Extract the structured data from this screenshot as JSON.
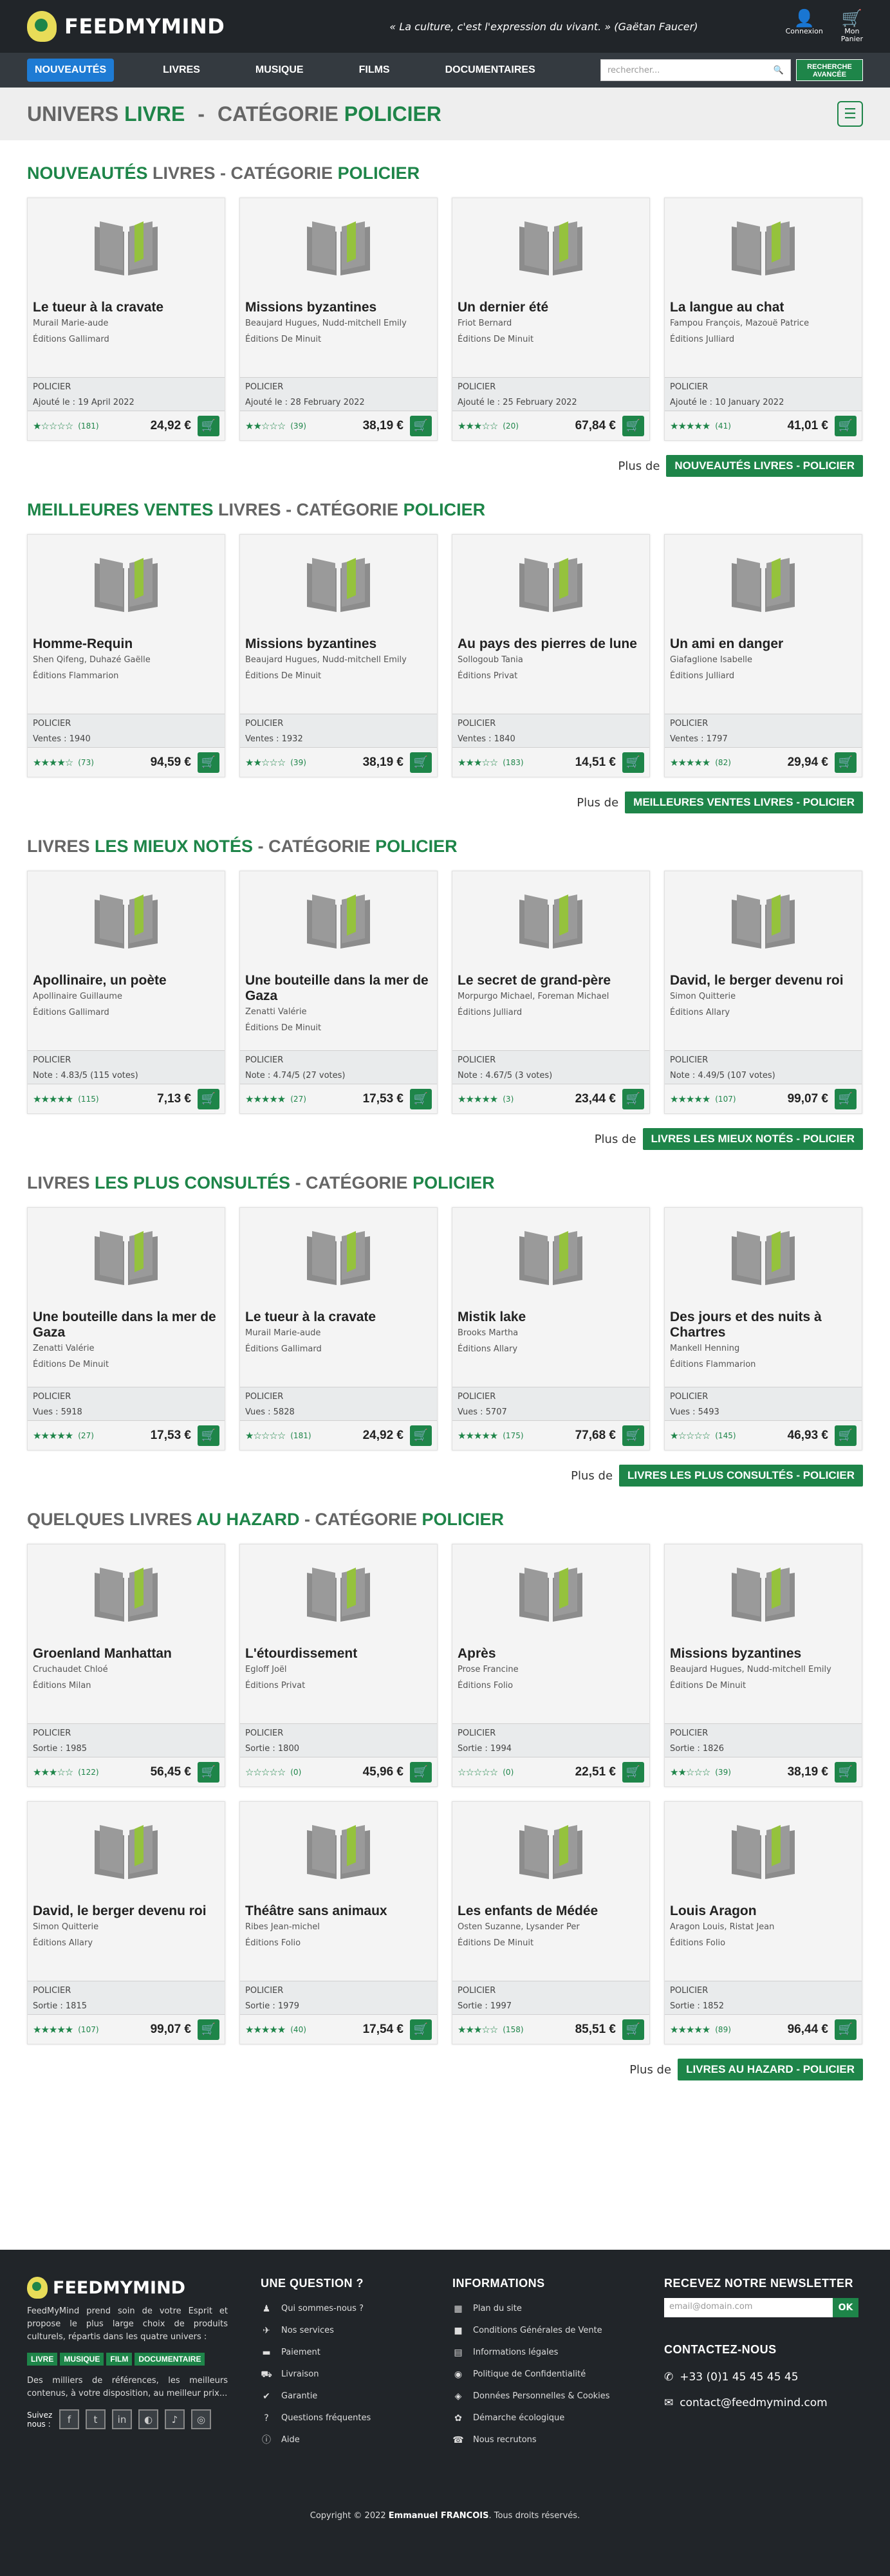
{
  "header": {
    "logo_text": "FEEDMYMIND",
    "quote": "« La culture, c'est l'expression du vivant. »",
    "quote_author": "(Gaëtan Faucer)",
    "login_label": "Connexion",
    "cart_label_1": "Mon",
    "cart_label_2": "Panier"
  },
  "nav": {
    "items": [
      "NOUVEAUTÉS",
      "LIVRES",
      "MUSIQUE",
      "FILMS",
      "DOCUMENTAIRES"
    ],
    "search_placeholder": "rechercher...",
    "adv_search_1": "RECHERCHE",
    "adv_search_2": "AVANCÉE"
  },
  "page": {
    "title_a": "UNIVERS ",
    "title_b": "LIVRE",
    "title_sep": "-",
    "title_c": "CATÉGORIE ",
    "title_d": "POLICIER"
  },
  "more_label": "Plus de",
  "sections": [
    {
      "title_parts": [
        [
          "NOUVEAUTÉS",
          true
        ],
        [
          " LIVRES - CATÉGORIE ",
          false
        ],
        [
          "POLICIER",
          true
        ]
      ],
      "more_button": "NOUVEAUTÉS LIVRES - POLICIER",
      "rows": [
        [
          {
            "title": "Le tueur à la cravate",
            "author": "Murail Marie-aude",
            "publisher": "Éditions Gallimard",
            "category": "POLICIER",
            "stat": "Ajouté le : 19 April 2022",
            "stars": "★☆☆☆☆",
            "count": "(181)",
            "price": "24,92 €"
          },
          {
            "title": "Missions byzantines",
            "author": "Beaujard Hugues, Nudd-mitchell Emily",
            "publisher": "Éditions De Minuit",
            "category": "POLICIER",
            "stat": "Ajouté le : 28 February 2022",
            "stars": "★★☆☆☆",
            "count": "(39)",
            "price": "38,19 €"
          },
          {
            "title": "Un dernier été",
            "author": "Friot Bernard",
            "publisher": "Éditions De Minuit",
            "category": "POLICIER",
            "stat": "Ajouté le : 25 February 2022",
            "stars": "★★★☆☆",
            "count": "(20)",
            "price": "67,84 €"
          },
          {
            "title": "La langue au chat",
            "author": "Fampou François, Mazouë Patrice",
            "publisher": "Éditions Julliard",
            "category": "POLICIER",
            "stat": "Ajouté le : 10 January 2022",
            "stars": "★★★★★",
            "count": "(41)",
            "price": "41,01 €"
          }
        ]
      ]
    },
    {
      "title_parts": [
        [
          "MEILLEURES VENTES",
          true
        ],
        [
          " LIVRES - CATÉGORIE ",
          false
        ],
        [
          "POLICIER",
          true
        ]
      ],
      "more_button": "MEILLEURES VENTES LIVRES - POLICIER",
      "rows": [
        [
          {
            "title": "Homme-Requin",
            "author": "Shen Qifeng, Duhazé Gaëlle",
            "publisher": "Éditions Flammarion",
            "category": "POLICIER",
            "stat": "Ventes : 1940",
            "stars": "★★★★☆",
            "count": "(73)",
            "price": "94,59 €"
          },
          {
            "title": "Missions byzantines",
            "author": "Beaujard Hugues, Nudd-mitchell Emily",
            "publisher": "Éditions De Minuit",
            "category": "POLICIER",
            "stat": "Ventes : 1932",
            "stars": "★★☆☆☆",
            "count": "(39)",
            "price": "38,19 €"
          },
          {
            "title": "Au pays des pierres de lune",
            "author": "Sollogoub Tania",
            "publisher": "Éditions Privat",
            "category": "POLICIER",
            "stat": "Ventes : 1840",
            "stars": "★★★☆☆",
            "count": "(183)",
            "price": "14,51 €"
          },
          {
            "title": "Un ami en danger",
            "author": "Giafaglione Isabelle",
            "publisher": "Éditions Julliard",
            "category": "POLICIER",
            "stat": "Ventes : 1797",
            "stars": "★★★★★",
            "count": "(82)",
            "price": "29,94 €"
          }
        ]
      ]
    },
    {
      "title_parts": [
        [
          "LIVRES ",
          false
        ],
        [
          "LES MIEUX NOTÉS",
          true
        ],
        [
          " - CATÉGORIE ",
          false
        ],
        [
          "POLICIER",
          true
        ]
      ],
      "more_button": "LIVRES LES MIEUX NOTÉS - POLICIER",
      "rows": [
        [
          {
            "title": "Apollinaire, un poète",
            "author": "Apollinaire Guillaume",
            "publisher": "Éditions Gallimard",
            "category": "POLICIER",
            "stat": "Note : 4.83/5 (115 votes)",
            "stars": "★★★★★",
            "count": "(115)",
            "price": "7,13 €"
          },
          {
            "title": "Une bouteille dans la mer de Gaza",
            "author": "Zenatti Valérie",
            "publisher": "Éditions De Minuit",
            "category": "POLICIER",
            "stat": "Note : 4.74/5 (27 votes)",
            "stars": "★★★★★",
            "count": "(27)",
            "price": "17,53 €"
          },
          {
            "title": "Le secret de grand-père",
            "author": "Morpurgo Michael, Foreman Michael",
            "publisher": "Éditions Julliard",
            "category": "POLICIER",
            "stat": "Note : 4.67/5 (3 votes)",
            "stars": "★★★★★",
            "count": "(3)",
            "price": "23,44 €"
          },
          {
            "title": "David, le berger devenu roi",
            "author": "Simon Quitterie",
            "publisher": "Éditions Allary",
            "category": "POLICIER",
            "stat": "Note : 4.49/5 (107 votes)",
            "stars": "★★★★★",
            "count": "(107)",
            "price": "99,07 €"
          }
        ]
      ]
    },
    {
      "title_parts": [
        [
          "LIVRES ",
          false
        ],
        [
          "LES PLUS CONSULTÉS",
          true
        ],
        [
          " - CATÉGORIE ",
          false
        ],
        [
          "POLICIER",
          true
        ]
      ],
      "more_button": "LIVRES LES PLUS CONSULTÉS - POLICIER",
      "rows": [
        [
          {
            "title": "Une bouteille dans la mer de Gaza",
            "author": "Zenatti Valérie",
            "publisher": "Éditions De Minuit",
            "category": "POLICIER",
            "stat": "Vues : 5918",
            "stars": "★★★★★",
            "count": "(27)",
            "price": "17,53 €"
          },
          {
            "title": "Le tueur à la cravate",
            "author": "Murail Marie-aude",
            "publisher": "Éditions Gallimard",
            "category": "POLICIER",
            "stat": "Vues : 5828",
            "stars": "★☆☆☆☆",
            "count": "(181)",
            "price": "24,92 €"
          },
          {
            "title": "Mistik lake",
            "author": "Brooks Martha",
            "publisher": "Éditions Allary",
            "category": "POLICIER",
            "stat": "Vues : 5707",
            "stars": "★★★★★",
            "count": "(175)",
            "price": "77,68 €"
          },
          {
            "title": "Des jours et des nuits à Chartres",
            "author": "Mankell Henning",
            "publisher": "Éditions Flammarion",
            "category": "POLICIER",
            "stat": "Vues : 5493",
            "stars": "★☆☆☆☆",
            "count": "(145)",
            "price": "46,93 €"
          }
        ]
      ]
    },
    {
      "title_parts": [
        [
          "QUELQUES LIVRES ",
          false
        ],
        [
          "AU HAZARD",
          true
        ],
        [
          " - CATÉGORIE ",
          false
        ],
        [
          "POLICIER",
          true
        ]
      ],
      "more_button": "LIVRES AU HAZARD - POLICIER",
      "rows": [
        [
          {
            "title": "Groenland Manhattan",
            "author": "Cruchaudet Chloé",
            "publisher": "Éditions Milan",
            "category": "POLICIER",
            "stat": "Sortie : 1985",
            "stars": "★★★☆☆",
            "count": "(122)",
            "price": "56,45 €"
          },
          {
            "title": "L'étourdissement",
            "author": "Egloff Joël",
            "publisher": "Éditions Privat",
            "category": "POLICIER",
            "stat": "Sortie : 1800",
            "stars": "☆☆☆☆☆",
            "count": "(0)",
            "price": "45,96 €"
          },
          {
            "title": "Après",
            "author": "Prose Francine",
            "publisher": "Éditions Folio",
            "category": "POLICIER",
            "stat": "Sortie : 1994",
            "stars": "☆☆☆☆☆",
            "count": "(0)",
            "price": "22,51 €"
          },
          {
            "title": "Missions byzantines",
            "author": "Beaujard Hugues, Nudd-mitchell Emily",
            "publisher": "Éditions De Minuit",
            "category": "POLICIER",
            "stat": "Sortie : 1826",
            "stars": "★★☆☆☆",
            "count": "(39)",
            "price": "38,19 €"
          }
        ],
        [
          {
            "title": "David, le berger devenu roi",
            "author": "Simon Quitterie",
            "publisher": "Éditions Allary",
            "category": "POLICIER",
            "stat": "Sortie : 1815",
            "stars": "★★★★★",
            "count": "(107)",
            "price": "99,07 €"
          },
          {
            "title": "Théâtre sans animaux",
            "author": "Ribes Jean-michel",
            "publisher": "Éditions Folio",
            "category": "POLICIER",
            "stat": "Sortie : 1979",
            "stars": "★★★★★",
            "count": "(40)",
            "price": "17,54 €"
          },
          {
            "title": "Les enfants de Médée",
            "author": "Osten Suzanne, Lysander Per",
            "publisher": "Éditions De Minuit",
            "category": "POLICIER",
            "stat": "Sortie : 1997",
            "stars": "★★★☆☆",
            "count": "(158)",
            "price": "85,51 €"
          },
          {
            "title": "Louis Aragon",
            "author": "Aragon Louis, Ristat Jean",
            "publisher": "Éditions Folio",
            "category": "POLICIER",
            "stat": "Sortie : 1852",
            "stars": "★★★★★",
            "count": "(89)",
            "price": "96,44 €"
          }
        ]
      ]
    }
  ],
  "footer": {
    "logo_text": "FEEDMYMIND",
    "description": "FeedMyMind prend soin de votre Esprit et propose le plus large choix de produits culturels, répartis dans les quatre univers :",
    "tags": [
      "LIVRE",
      "MUSIQUE",
      "FILM",
      "DOCUMENTAIRE"
    ],
    "description2": "Des milliers de références, les meilleurs contenus, à votre disposition, au meilleur prix...",
    "follow_label": "Suivez nous :",
    "question_title": "UNE QUESTION ?",
    "question_links": [
      {
        "icon": "♟",
        "label": "Qui sommes-nous ?"
      },
      {
        "icon": "✈",
        "label": "Nos services"
      },
      {
        "icon": "▬",
        "label": "Paiement"
      },
      {
        "icon": "⛟",
        "label": "Livraison"
      },
      {
        "icon": "✔",
        "label": "Garantie"
      },
      {
        "icon": "?",
        "label": "Questions fréquentes"
      },
      {
        "icon": "ⓘ",
        "label": "Aide"
      }
    ],
    "info_title": "INFORMATIONS",
    "info_links": [
      {
        "icon": "▦",
        "label": "Plan du site"
      },
      {
        "icon": "■",
        "label": "Conditions Générales de Vente"
      },
      {
        "icon": "▤",
        "label": "Informations légales"
      },
      {
        "icon": "◉",
        "label": "Politique de Confidentialité"
      },
      {
        "icon": "◈",
        "label": "Données Personnelles & Cookies"
      },
      {
        "icon": "✿",
        "label": "Démarche écologique"
      },
      {
        "icon": "☎",
        "label": "Nous recrutons"
      }
    ],
    "newsletter_title": "RECEVEZ NOTRE NEWSLETTER",
    "newsletter_placeholder": "email@domain.com",
    "newsletter_ok": "OK",
    "contact_title": "CONTACTEZ-NOUS",
    "phone": "+33 (0)1 45 45 45 45",
    "email": "contact@feedmymind.com",
    "copyright_pre": "Copyright © 2022 ",
    "copyright_name": "Emmanuel FRANCOIS",
    "copyright_post": ". Tous droits réservés."
  }
}
